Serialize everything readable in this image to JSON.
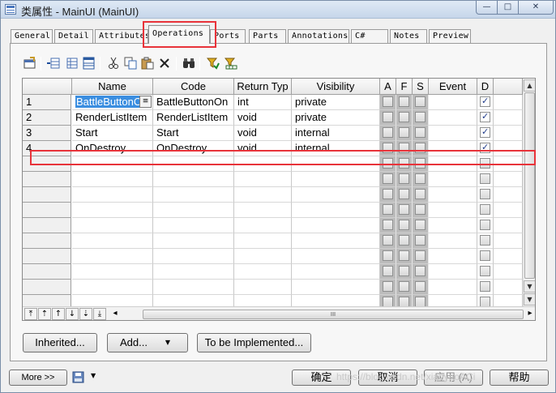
{
  "window": {
    "title": "类属性 - MainUI (MainUI)",
    "controls": {
      "minimize": "—",
      "maximize": "□",
      "close": "✕"
    }
  },
  "tabs": [
    {
      "label": "General",
      "active": false
    },
    {
      "label": "Detail",
      "active": false
    },
    {
      "label": "Attributes",
      "active": false
    },
    {
      "label": "Operations",
      "active": true
    },
    {
      "label": "Ports",
      "active": false
    },
    {
      "label": "Parts",
      "active": false
    },
    {
      "label": "Annotations",
      "active": false
    },
    {
      "label": "C#",
      "active": false
    },
    {
      "label": "Notes",
      "active": false
    },
    {
      "label": "Preview",
      "active": false
    }
  ],
  "toolbar": {
    "icons": [
      "properties-icon",
      "insert-row-icon",
      "add-row-icon",
      "add-rows-icon",
      "cut-icon",
      "copy-icon",
      "paste-icon",
      "delete-icon",
      "find-icon",
      "filter-icon",
      "customize-columns-icon"
    ]
  },
  "grid": {
    "columns": [
      "Name",
      "Code",
      "Return Typ",
      "Visibility",
      "A",
      "F",
      "S",
      "Event",
      "D"
    ],
    "rows": [
      {
        "num": "1",
        "name": "BattleButtonC",
        "code": "BattleButtonOn",
        "return_type": "int",
        "visibility": "private",
        "d": true,
        "dropdown": "≡"
      },
      {
        "num": "2",
        "name": "RenderListItem",
        "code": "RenderListItem",
        "return_type": "void",
        "visibility": "private",
        "d": true
      },
      {
        "num": "3",
        "name": "Start",
        "code": "Start",
        "return_type": "void",
        "visibility": "internal",
        "d": true
      },
      {
        "num": "4",
        "name": "OnDestroy",
        "code": "OnDestroy",
        "return_type": "void",
        "visibility": "internal",
        "d": true
      }
    ],
    "empty_rows": 11,
    "scroll_grip": "III"
  },
  "grid_nav": [
    "⤒",
    "⇡",
    "↑",
    "↓",
    "⇣",
    "⤓"
  ],
  "buttons": {
    "inherited": "Inherited...",
    "add": "Add...",
    "to_be_implemented": "To be Implemented...",
    "more": "More >>",
    "ok": "确定",
    "cancel": "取消",
    "apply": "应用 (A)",
    "help": "帮助"
  },
  "watermark": "https://blog.csdn.net/xiaoyaoACi"
}
